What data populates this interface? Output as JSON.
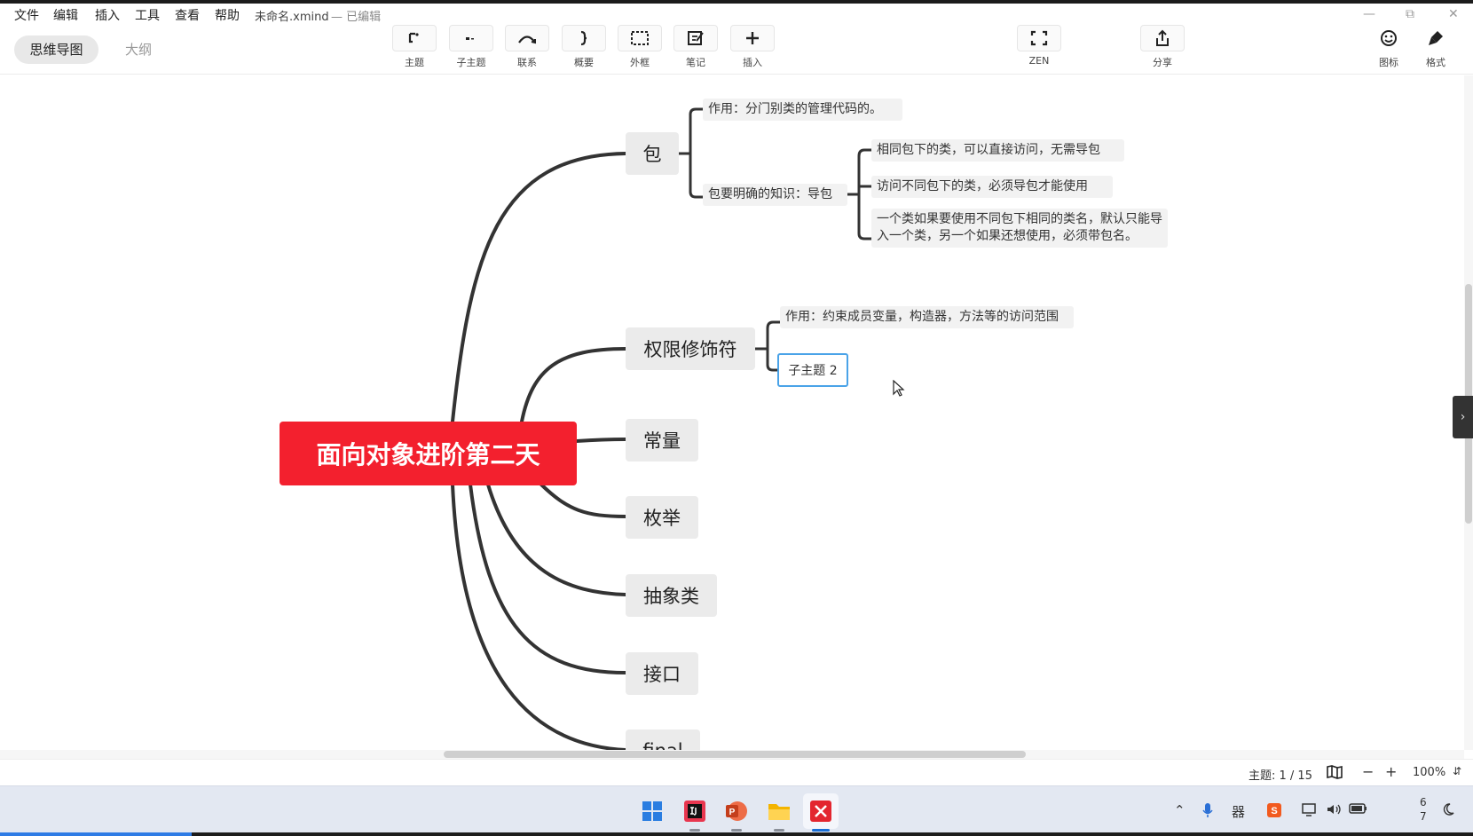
{
  "menu": {
    "items": [
      "文件",
      "编辑",
      "插入",
      "工具",
      "查看",
      "帮助"
    ],
    "doc_title": "未命名.xmind",
    "doc_status": "— 已编辑"
  },
  "view_switch": {
    "mindmap": "思维导图",
    "outline": "大纲"
  },
  "toolbar": {
    "tools": [
      {
        "label": "主题",
        "icon": "topic-icon"
      },
      {
        "label": "子主题",
        "icon": "subtopic-icon"
      },
      {
        "label": "联系",
        "icon": "relationship-icon"
      },
      {
        "label": "概要",
        "icon": "summary-icon"
      },
      {
        "label": "外框",
        "icon": "boundary-icon"
      },
      {
        "label": "笔记",
        "icon": "note-icon"
      },
      {
        "label": "插入",
        "icon": "plus-icon"
      }
    ],
    "zen": "ZEN",
    "share": "分享",
    "icons": "图标",
    "format": "格式"
  },
  "mindmap": {
    "central": "面向对象进阶第二天",
    "topics": [
      {
        "label": "包"
      },
      {
        "label": "权限修饰符"
      },
      {
        "label": "常量"
      },
      {
        "label": "枚举"
      },
      {
        "label": "抽象类"
      },
      {
        "label": "接口"
      },
      {
        "label": "final"
      }
    ],
    "package_children": {
      "purpose": "作用：分门别类的管理代码的。",
      "import_knowledge": "包要明确的知识：导包",
      "import_rules": [
        "相同包下的类，可以直接访问，无需导包",
        "访问不同包下的类，必须导包才能使用",
        "一个类如果要使用不同包下相同的类名，默认只能导入一个类，另一个如果还想使用，必须带包名。"
      ]
    },
    "modifier_children": {
      "purpose": "作用：约束成员变量，构造器，方法等的访问范围",
      "subtopic2": "子主题 2"
    }
  },
  "status": {
    "topic_count": "主题: 1 / 15",
    "zoom": "100%"
  },
  "taskbar": {
    "apps": [
      "windows-start",
      "intellij-idea",
      "powerpoint",
      "file-explorer",
      "xmind"
    ],
    "clock_line1": "6",
    "clock_line2": "7"
  },
  "colors": {
    "central": "#f3202e",
    "selection": "#4aa3e8",
    "branch": "#333333"
  }
}
